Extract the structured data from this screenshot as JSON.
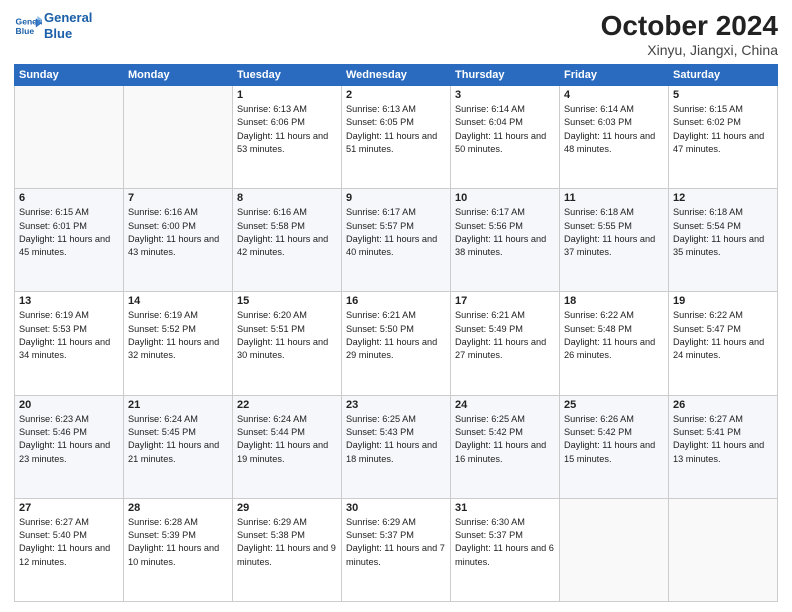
{
  "header": {
    "logo_line1": "General",
    "logo_line2": "Blue",
    "month": "October 2024",
    "location": "Xinyu, Jiangxi, China"
  },
  "weekdays": [
    "Sunday",
    "Monday",
    "Tuesday",
    "Wednesday",
    "Thursday",
    "Friday",
    "Saturday"
  ],
  "weeks": [
    [
      {
        "day": "",
        "info": ""
      },
      {
        "day": "",
        "info": ""
      },
      {
        "day": "1",
        "info": "Sunrise: 6:13 AM\nSunset: 6:06 PM\nDaylight: 11 hours and 53 minutes."
      },
      {
        "day": "2",
        "info": "Sunrise: 6:13 AM\nSunset: 6:05 PM\nDaylight: 11 hours and 51 minutes."
      },
      {
        "day": "3",
        "info": "Sunrise: 6:14 AM\nSunset: 6:04 PM\nDaylight: 11 hours and 50 minutes."
      },
      {
        "day": "4",
        "info": "Sunrise: 6:14 AM\nSunset: 6:03 PM\nDaylight: 11 hours and 48 minutes."
      },
      {
        "day": "5",
        "info": "Sunrise: 6:15 AM\nSunset: 6:02 PM\nDaylight: 11 hours and 47 minutes."
      }
    ],
    [
      {
        "day": "6",
        "info": "Sunrise: 6:15 AM\nSunset: 6:01 PM\nDaylight: 11 hours and 45 minutes."
      },
      {
        "day": "7",
        "info": "Sunrise: 6:16 AM\nSunset: 6:00 PM\nDaylight: 11 hours and 43 minutes."
      },
      {
        "day": "8",
        "info": "Sunrise: 6:16 AM\nSunset: 5:58 PM\nDaylight: 11 hours and 42 minutes."
      },
      {
        "day": "9",
        "info": "Sunrise: 6:17 AM\nSunset: 5:57 PM\nDaylight: 11 hours and 40 minutes."
      },
      {
        "day": "10",
        "info": "Sunrise: 6:17 AM\nSunset: 5:56 PM\nDaylight: 11 hours and 38 minutes."
      },
      {
        "day": "11",
        "info": "Sunrise: 6:18 AM\nSunset: 5:55 PM\nDaylight: 11 hours and 37 minutes."
      },
      {
        "day": "12",
        "info": "Sunrise: 6:18 AM\nSunset: 5:54 PM\nDaylight: 11 hours and 35 minutes."
      }
    ],
    [
      {
        "day": "13",
        "info": "Sunrise: 6:19 AM\nSunset: 5:53 PM\nDaylight: 11 hours and 34 minutes."
      },
      {
        "day": "14",
        "info": "Sunrise: 6:19 AM\nSunset: 5:52 PM\nDaylight: 11 hours and 32 minutes."
      },
      {
        "day": "15",
        "info": "Sunrise: 6:20 AM\nSunset: 5:51 PM\nDaylight: 11 hours and 30 minutes."
      },
      {
        "day": "16",
        "info": "Sunrise: 6:21 AM\nSunset: 5:50 PM\nDaylight: 11 hours and 29 minutes."
      },
      {
        "day": "17",
        "info": "Sunrise: 6:21 AM\nSunset: 5:49 PM\nDaylight: 11 hours and 27 minutes."
      },
      {
        "day": "18",
        "info": "Sunrise: 6:22 AM\nSunset: 5:48 PM\nDaylight: 11 hours and 26 minutes."
      },
      {
        "day": "19",
        "info": "Sunrise: 6:22 AM\nSunset: 5:47 PM\nDaylight: 11 hours and 24 minutes."
      }
    ],
    [
      {
        "day": "20",
        "info": "Sunrise: 6:23 AM\nSunset: 5:46 PM\nDaylight: 11 hours and 23 minutes."
      },
      {
        "day": "21",
        "info": "Sunrise: 6:24 AM\nSunset: 5:45 PM\nDaylight: 11 hours and 21 minutes."
      },
      {
        "day": "22",
        "info": "Sunrise: 6:24 AM\nSunset: 5:44 PM\nDaylight: 11 hours and 19 minutes."
      },
      {
        "day": "23",
        "info": "Sunrise: 6:25 AM\nSunset: 5:43 PM\nDaylight: 11 hours and 18 minutes."
      },
      {
        "day": "24",
        "info": "Sunrise: 6:25 AM\nSunset: 5:42 PM\nDaylight: 11 hours and 16 minutes."
      },
      {
        "day": "25",
        "info": "Sunrise: 6:26 AM\nSunset: 5:42 PM\nDaylight: 11 hours and 15 minutes."
      },
      {
        "day": "26",
        "info": "Sunrise: 6:27 AM\nSunset: 5:41 PM\nDaylight: 11 hours and 13 minutes."
      }
    ],
    [
      {
        "day": "27",
        "info": "Sunrise: 6:27 AM\nSunset: 5:40 PM\nDaylight: 11 hours and 12 minutes."
      },
      {
        "day": "28",
        "info": "Sunrise: 6:28 AM\nSunset: 5:39 PM\nDaylight: 11 hours and 10 minutes."
      },
      {
        "day": "29",
        "info": "Sunrise: 6:29 AM\nSunset: 5:38 PM\nDaylight: 11 hours and 9 minutes."
      },
      {
        "day": "30",
        "info": "Sunrise: 6:29 AM\nSunset: 5:37 PM\nDaylight: 11 hours and 7 minutes."
      },
      {
        "day": "31",
        "info": "Sunrise: 6:30 AM\nSunset: 5:37 PM\nDaylight: 11 hours and 6 minutes."
      },
      {
        "day": "",
        "info": ""
      },
      {
        "day": "",
        "info": ""
      }
    ]
  ]
}
